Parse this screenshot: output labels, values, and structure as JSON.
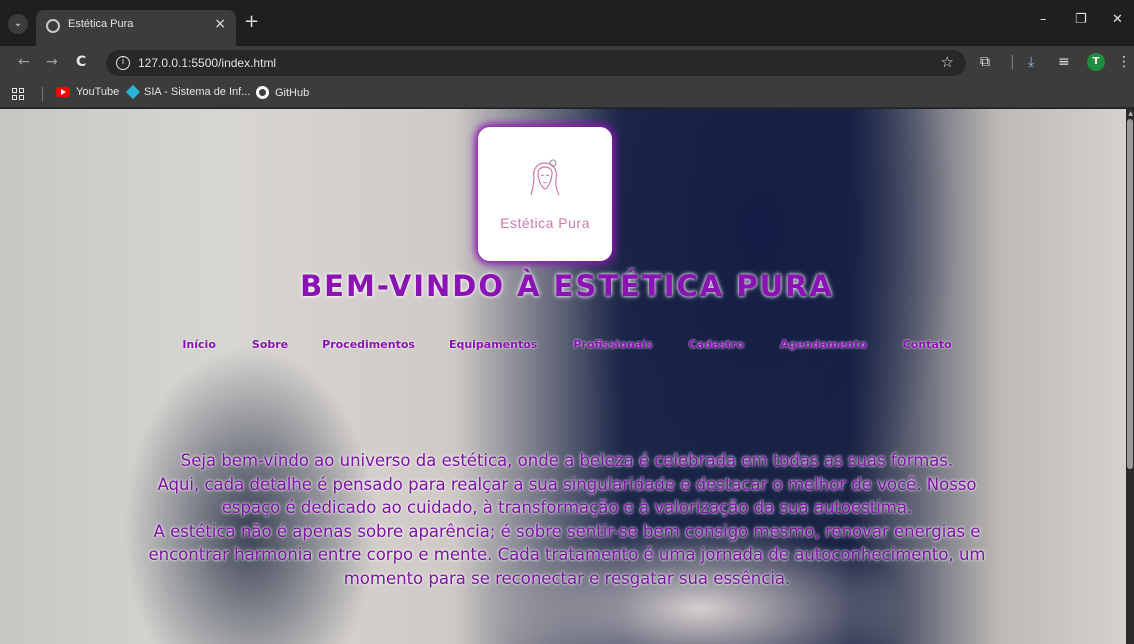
{
  "browser": {
    "tab": {
      "title": "Estética Pura",
      "close": "×"
    },
    "new_tab": "+",
    "window_controls": {
      "minimize": "–",
      "restore": "❐",
      "close": "✕"
    },
    "nav": {
      "back": "←",
      "forward": "→",
      "reload": "C"
    },
    "url": "127.0.0.1:5500/index.html",
    "profile_initial": "T",
    "bookmarks": [
      {
        "label": "YouTube",
        "icon": "youtube-icon"
      },
      {
        "label": "SIA - Sistema de Inf...",
        "icon": "sia-icon"
      },
      {
        "label": "GitHub",
        "icon": "github-icon"
      }
    ]
  },
  "page": {
    "logo_text": "Estética Pura",
    "title": "BEM-VINDO À ESTÉTICA PURA",
    "nav": [
      "Início",
      "Sobre",
      "Procedimentos",
      "Equipamentos",
      "Profissionais",
      "Cadastro",
      "Agendamento",
      "Contato"
    ],
    "intro_lines": [
      "Seja bem-vindo ao universo da estética, onde a beleza é celebrada em todas as suas formas.",
      "Aqui, cada detalhe é pensado para realçar a sua singularidade e destacar o melhor de você. Nosso",
      "espaço é dedicado ao cuidado, à transformação e à valorização da sua autoestima.",
      "A estética não é apenas sobre aparência; é sobre sentir-se bem consigo mesmo, renovar energias e",
      "encontrar harmonia entre corpo e mente. Cada tratamento é uma jornada de autoconhecimento, um",
      "momento para se reconectar e resgatar sua essência."
    ]
  },
  "colors": {
    "accent_purple": "#8b12b3",
    "logo_pink": "#d07aa8"
  }
}
